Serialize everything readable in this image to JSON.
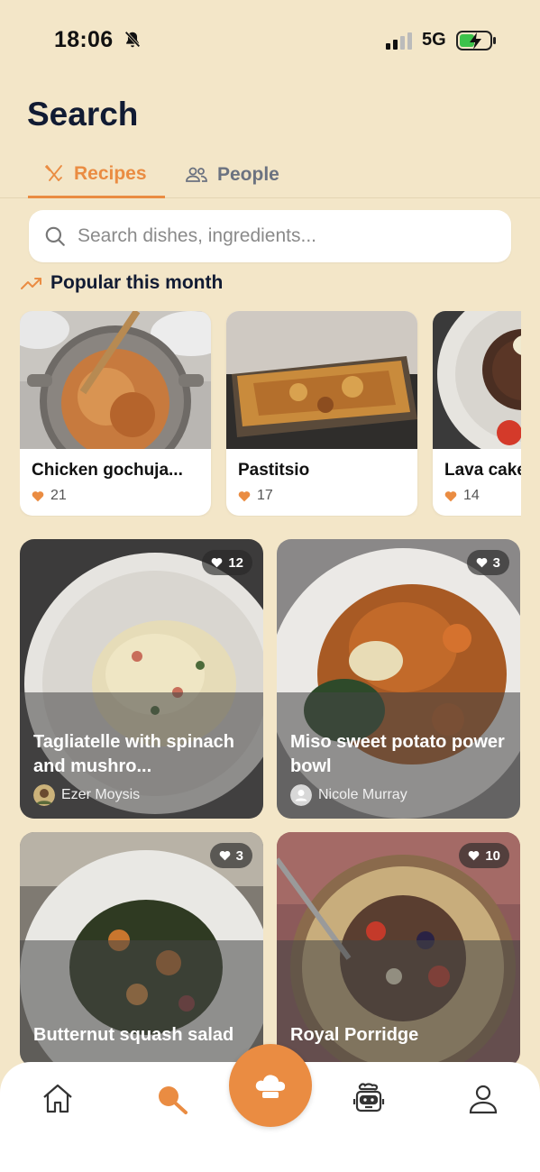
{
  "status_bar": {
    "time": "18:06",
    "network": "5G",
    "icons": [
      "bell-slash-icon",
      "signal-icon",
      "battery-charging-icon"
    ]
  },
  "header": {
    "title": "Search"
  },
  "tabs": [
    {
      "label": "Recipes",
      "icon": "utensils-icon",
      "active": true
    },
    {
      "label": "People",
      "icon": "users-icon",
      "active": false
    }
  ],
  "search": {
    "placeholder": "Search dishes, ingredients...",
    "value": ""
  },
  "popular": {
    "heading": "Popular this month",
    "icon": "trending-up-icon",
    "items": [
      {
        "title": "Chicken gochuja...",
        "likes": "21"
      },
      {
        "title": "Pastitsio",
        "likes": "17"
      },
      {
        "title": "Lava cake",
        "likes": "14"
      }
    ]
  },
  "recipes": [
    {
      "title": "Tagliatelle with spinach and mushro...",
      "likes": "12",
      "author": "Ezer Moysis"
    },
    {
      "title": "Miso sweet potato power bowl",
      "likes": "3",
      "author": "Nicole Murray"
    },
    {
      "title": "Butternut squash salad",
      "likes": "3",
      "author": ""
    },
    {
      "title": "Royal Porridge",
      "likes": "10",
      "author": ""
    }
  ],
  "bottom_nav": {
    "items": [
      "home-icon",
      "search-icon",
      "chef-hat-icon",
      "robot-icon",
      "profile-icon"
    ],
    "active": "search-icon"
  },
  "colors": {
    "accent": "#ea8c42",
    "background": "#f3e6c8",
    "text": "#111b33"
  }
}
